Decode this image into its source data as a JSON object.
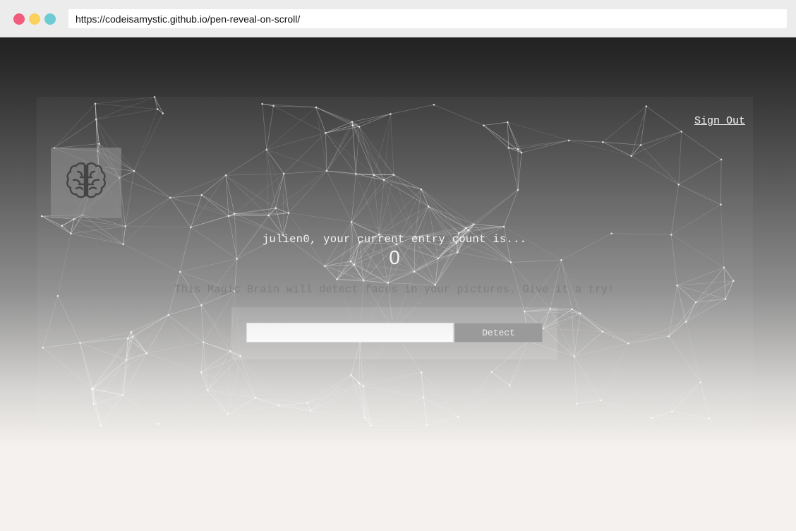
{
  "browser": {
    "url": "https://codeisamystic.github.io/pen-reveal-on-scroll/",
    "dots": {
      "red": "#f25c7a",
      "yellow": "#fbd15b",
      "green": "#6ccbd3"
    }
  },
  "header": {
    "sign_out": "Sign Out"
  },
  "logo": {
    "icon": "brain-icon"
  },
  "main": {
    "greeting": "julien0, your current entry count is...",
    "count": "0",
    "hint": "This Magic Brain will detect faces in your pictures. Give it a try!"
  },
  "form": {
    "input_value": "",
    "button_label": "Detect"
  }
}
